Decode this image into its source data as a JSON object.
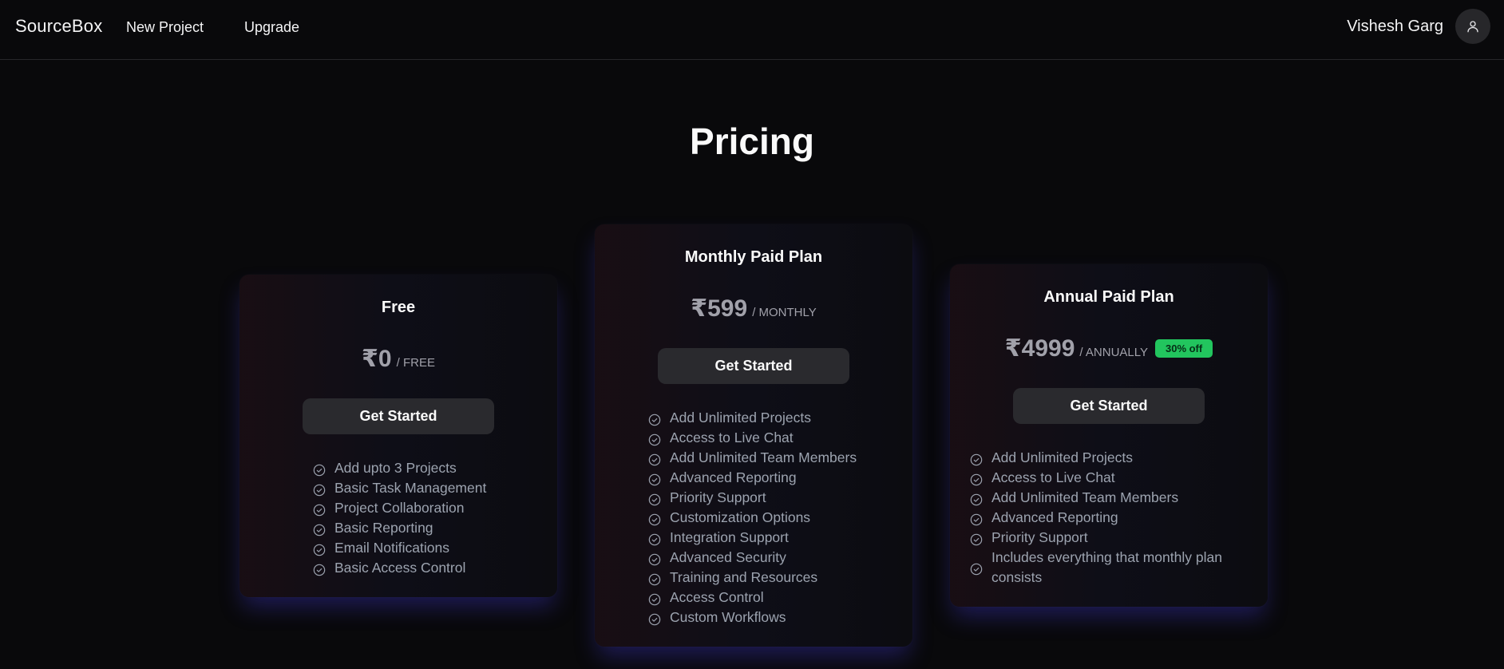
{
  "nav": {
    "brand": "SourceBox",
    "links": [
      "New Project",
      "Upgrade"
    ],
    "user_name": "Vishesh Garg",
    "avatar_icon": "user-icon"
  },
  "page": {
    "title": "Pricing"
  },
  "plans": [
    {
      "name": "Free",
      "price": "₹0",
      "period": "/ FREE",
      "cta": "Get Started",
      "features": [
        "Add upto 3 Projects",
        "Basic Task Management",
        "Project Collaboration",
        "Basic Reporting",
        "Email Notifications",
        "Basic Access Control"
      ]
    },
    {
      "name": "Monthly Paid Plan",
      "price": "₹599",
      "period": "/ MONTHLY",
      "cta": "Get Started",
      "features": [
        "Add Unlimited Projects",
        "Access to Live Chat",
        "Add Unlimited Team Members",
        "Advanced Reporting",
        "Priority Support",
        "Customization Options",
        "Integration Support",
        "Advanced Security",
        "Training and Resources",
        "Access Control",
        "Custom Workflows"
      ]
    },
    {
      "name": "Annual Paid Plan",
      "price": "₹4999",
      "period": "/ ANNUALLY",
      "badge": "30% off",
      "cta": "Get Started",
      "features": [
        "Add Unlimited Projects",
        "Access to Live Chat",
        "Add Unlimited Team Members",
        "Advanced Reporting",
        "Priority Support",
        "Includes everything that monthly plan consists"
      ]
    }
  ],
  "colors": {
    "background": "#09090b",
    "muted_text": "#9ca3af",
    "button": "#2a2a2e",
    "badge": "#22c55e",
    "glow": "#4f46e5"
  },
  "icons": {
    "feature": "check-circle-icon"
  }
}
